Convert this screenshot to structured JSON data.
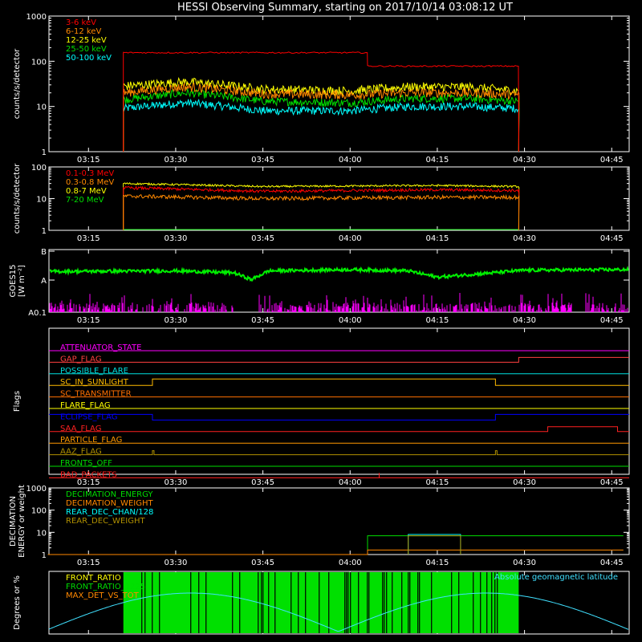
{
  "title": "HESSI Observing Summary, starting on 2017/10/14 03:08:12 UT",
  "time_ticks": [
    "03:15",
    "03:30",
    "03:45",
    "04:00",
    "04:15",
    "04:30",
    "04:45"
  ],
  "chart_data": [
    {
      "type": "line",
      "ylabel": "counts/s/detector",
      "yscale": "log",
      "ylim": [
        1,
        1000
      ],
      "y_ticks": [
        "1",
        "10",
        "100",
        "1000"
      ],
      "legend_position": "top-left",
      "series": [
        {
          "name": "3-6 keV",
          "color": "#ff0000",
          "x": [
            "03:21",
            "03:21",
            "04:03",
            "04:03",
            "04:29",
            "04:29"
          ],
          "values": [
            1,
            155,
            155,
            78,
            74,
            1
          ]
        },
        {
          "name": "6-12 keV",
          "color": "#ff8800",
          "x": [
            "03:21",
            "03:21",
            "03:32",
            "03:45",
            "04:00",
            "04:10",
            "04:20",
            "04:29",
            "04:29"
          ],
          "values": [
            1,
            20,
            27,
            19,
            18,
            20,
            20,
            18,
            1
          ]
        },
        {
          "name": "12-25 keV",
          "color": "#ffff00",
          "x": [
            "03:21",
            "03:21",
            "03:32",
            "03:45",
            "04:00",
            "04:10",
            "04:20",
            "04:29",
            "04:29"
          ],
          "values": [
            1,
            28,
            35,
            24,
            22,
            27,
            27,
            22,
            1
          ]
        },
        {
          "name": "25-50 keV",
          "color": "#00dd00",
          "x": [
            "03:21",
            "03:21",
            "03:32",
            "03:45",
            "04:00",
            "04:10",
            "04:20",
            "04:29",
            "04:29"
          ],
          "values": [
            1,
            14,
            20,
            13,
            12,
            15,
            15,
            13,
            1
          ]
        },
        {
          "name": "50-100 keV",
          "color": "#00ffff",
          "x": [
            "03:21",
            "03:21",
            "03:32",
            "03:45",
            "04:00",
            "04:10",
            "04:20",
            "04:29",
            "04:29"
          ],
          "values": [
            1,
            9,
            12,
            8,
            8,
            10,
            10,
            9,
            1
          ]
        }
      ]
    },
    {
      "type": "line",
      "ylabel": "counts/s/detector",
      "yscale": "log",
      "ylim": [
        1,
        100
      ],
      "y_ticks": [
        "1",
        "10",
        "100"
      ],
      "legend_position": "top-left",
      "series": [
        {
          "name": "0.1-0.3 MeV",
          "color": "#ff0000",
          "x": [
            "03:21",
            "03:21",
            "03:45",
            "04:15",
            "04:29",
            "04:29"
          ],
          "values": [
            1,
            22,
            17,
            19,
            18,
            1
          ]
        },
        {
          "name": "0.3-0.8 MeV",
          "color": "#ff8800",
          "x": [
            "03:21",
            "03:21",
            "03:45",
            "04:15",
            "04:29",
            "04:29"
          ],
          "values": [
            1,
            12,
            10,
            11,
            11,
            1
          ]
        },
        {
          "name": "0.8-7 MeV",
          "color": "#ffff00",
          "x": [
            "03:21",
            "03:21",
            "03:45",
            "04:15",
            "04:29",
            "04:29"
          ],
          "values": [
            1,
            30,
            24,
            26,
            24,
            1
          ]
        },
        {
          "name": "7-20 MeV",
          "color": "#00dd00",
          "x": [
            "03:21",
            "03:21",
            "04:29",
            "04:29"
          ],
          "values": [
            1,
            1,
            1,
            1
          ]
        }
      ]
    },
    {
      "type": "line",
      "ylabel": "GOES15",
      "ylabel2": "[W m⁻²]",
      "y_ticks": [
        "A0.1",
        "A",
        "B"
      ],
      "series": [
        {
          "name": "",
          "color": "#00ee00",
          "x": [
            "03:08",
            "03:30",
            "03:40",
            "03:43",
            "03:46",
            "04:00",
            "04:10",
            "04:15",
            "04:30",
            "04:47"
          ],
          "values": [
            0.65,
            0.66,
            0.63,
            0.52,
            0.66,
            0.68,
            0.66,
            0.56,
            0.67,
            0.68
          ]
        },
        {
          "name": "",
          "color": "#ff00ff",
          "x": [],
          "values": []
        }
      ]
    },
    {
      "type": "flags",
      "ylabel": "Flags",
      "flags": [
        {
          "name": "ATTENUATOR_STATE",
          "color": "#ff00ff"
        },
        {
          "name": "GAP_FLAG",
          "color": "#ff4040"
        },
        {
          "name": "POSSIBLE_FLARE",
          "color": "#00e0e0"
        },
        {
          "name": "SC_IN_SUNLIGHT",
          "color": "#ffbb00"
        },
        {
          "name": "SC_TRANSMITTER",
          "color": "#ff7000"
        },
        {
          "name": "FLARE_FLAG",
          "color": "#ffff00"
        },
        {
          "name": "ECLIPSE_FLAG",
          "color": "#0000ff"
        },
        {
          "name": "SAA_FLAG",
          "color": "#ff2020"
        },
        {
          "name": "PARTICLE_FLAG",
          "color": "#ff9900"
        },
        {
          "name": "AAZ_FLAG",
          "color": "#b09000"
        },
        {
          "name": "FRONTS_OFF",
          "color": "#00dd00"
        },
        {
          "name": "BAD_PACKETS",
          "color": "#ff2020"
        }
      ]
    },
    {
      "type": "line",
      "ylabel": "DECIMATION",
      "ylabel2": "ENERGY or weight",
      "yscale": "log",
      "ylim": [
        1,
        1000
      ],
      "y_ticks": [
        "1",
        "10",
        "100",
        "1000"
      ],
      "legend_position": "top-left",
      "series": [
        {
          "name": "DECIMATION_ENERGY",
          "color": "#00dd00",
          "x": [
            "03:08",
            "04:03",
            "04:03",
            "04:47"
          ],
          "values": [
            1,
            1,
            7,
            7
          ]
        },
        {
          "name": "DECIMATION_WEIGHT",
          "color": "#ff8800",
          "x": [
            "03:08",
            "04:03",
            "04:03",
            "04:47"
          ],
          "values": [
            1,
            1,
            1.6,
            1.6
          ]
        },
        {
          "name": "REAR_DEC_CHAN/128",
          "color": "#00ffff",
          "x": [
            "04:10",
            "04:19"
          ],
          "values": [
            8,
            8
          ]
        },
        {
          "name": "REAR_DEC_WEIGHT",
          "color": "#b09000",
          "x": [
            "04:10",
            "04:19"
          ],
          "values": [
            7,
            7
          ]
        }
      ]
    },
    {
      "type": "line",
      "ylabel": "Degrees or %",
      "legend_position": "top-left",
      "series": [
        {
          "name": "FRONT_RATIO",
          "color": "#ffff00",
          "x": [],
          "values": []
        },
        {
          "name": "FRONT_RATIO_1225",
          "color": "#00dd00",
          "x": [],
          "values": []
        },
        {
          "name": "MAX_DET_VS_TOT",
          "color": "#ff8800",
          "x": [],
          "values": []
        }
      ],
      "annotation": "Absolute geomagnetic latitude"
    }
  ]
}
